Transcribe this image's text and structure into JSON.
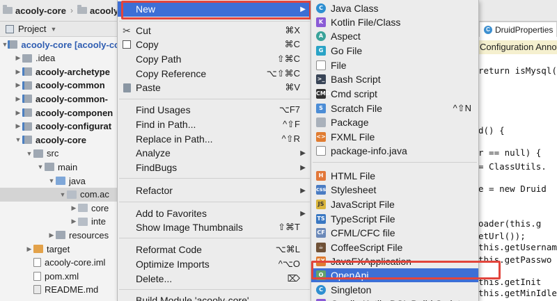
{
  "breadcrumb": [
    "acooly-core",
    "acooly-co"
  ],
  "project_header": {
    "label": "Project"
  },
  "tree": [
    {
      "label": "acooly-core [acooly-co",
      "style": "blue",
      "arrow": "▼",
      "depth": 0,
      "icon": "ic-mod"
    },
    {
      "label": ".idea",
      "style": "",
      "arrow": "▶",
      "depth": 1,
      "icon": "ic-folder"
    },
    {
      "label": "acooly-archetype",
      "style": "bold",
      "arrow": "▶",
      "depth": 1,
      "icon": "ic-mod"
    },
    {
      "label": "acooly-common",
      "style": "bold",
      "arrow": "▶",
      "depth": 1,
      "icon": "ic-mod"
    },
    {
      "label": "acooly-common-",
      "style": "bold",
      "arrow": "▶",
      "depth": 1,
      "icon": "ic-mod"
    },
    {
      "label": "acooly-componen",
      "style": "bold",
      "arrow": "▶",
      "depth": 1,
      "icon": "ic-mod"
    },
    {
      "label": "acooly-configurat",
      "style": "bold",
      "arrow": "▶",
      "depth": 1,
      "icon": "ic-mod"
    },
    {
      "label": "acooly-core",
      "style": "bold",
      "arrow": "▼",
      "depth": 1,
      "icon": "ic-mod"
    },
    {
      "label": "src",
      "style": "",
      "arrow": "▼",
      "depth": 2,
      "icon": "ic-folder"
    },
    {
      "label": "main",
      "style": "",
      "arrow": "▼",
      "depth": 3,
      "icon": "ic-folder"
    },
    {
      "label": "java",
      "style": "",
      "arrow": "▼",
      "depth": 4,
      "icon": "ic-src"
    },
    {
      "label": "com.ac",
      "style": "",
      "arrow": "▼",
      "depth": 5,
      "icon": "ic-pkg",
      "selected": true
    },
    {
      "label": "core",
      "style": "",
      "arrow": "▶",
      "depth": 6,
      "icon": "ic-pkg"
    },
    {
      "label": "inte",
      "style": "",
      "arrow": "▶",
      "depth": 6,
      "icon": "ic-pkg"
    },
    {
      "label": "resources",
      "style": "",
      "arrow": "▶",
      "depth": 4,
      "icon": "ic-folder"
    },
    {
      "label": "target",
      "style": "",
      "arrow": "▶",
      "depth": 2,
      "icon": "ic-target"
    },
    {
      "label": "acooly-core.iml",
      "style": "",
      "arrow": "",
      "depth": 2,
      "icon": "ic-file"
    },
    {
      "label": "pom.xml",
      "style": "",
      "arrow": "",
      "depth": 2,
      "icon": "ic-file"
    },
    {
      "label": "README.md",
      "style": "",
      "arrow": "",
      "depth": 2,
      "icon": "ic-md"
    }
  ],
  "menu": {
    "new": {
      "label": "New",
      "submenu_arrow": "▶"
    },
    "cut": {
      "label": "Cut",
      "shortcut": "⌘X"
    },
    "copy": {
      "label": "Copy",
      "shortcut": "⌘C"
    },
    "copy_path": {
      "label": "Copy Path",
      "shortcut": "⇧⌘C"
    },
    "copy_reference": {
      "label": "Copy Reference",
      "shortcut": "⌥⇧⌘C"
    },
    "paste": {
      "label": "Paste",
      "shortcut": "⌘V"
    },
    "find_usages": {
      "label": "Find Usages",
      "shortcut": "⌥F7"
    },
    "find_in_path": {
      "label": "Find in Path...",
      "shortcut": "^⇧F"
    },
    "replace_in_path": {
      "label": "Replace in Path...",
      "shortcut": "^⇧R"
    },
    "analyze": {
      "label": "Analyze",
      "submenu_arrow": "▶"
    },
    "findbugs": {
      "label": "FindBugs",
      "submenu_arrow": "▶"
    },
    "refactor": {
      "label": "Refactor",
      "submenu_arrow": "▶"
    },
    "add_to_favorites": {
      "label": "Add to Favorites",
      "submenu_arrow": "▶"
    },
    "show_image_thumbnails": {
      "label": "Show Image Thumbnails",
      "shortcut": "⇧⌘T"
    },
    "reformat_code": {
      "label": "Reformat Code",
      "shortcut": "⌥⌘L"
    },
    "optimize_imports": {
      "label": "Optimize Imports",
      "shortcut": "^⌥O"
    },
    "delete": {
      "label": "Delete...",
      "shortcut": "⌦"
    },
    "build_module": {
      "label": "Build Module 'acooly-core'"
    }
  },
  "submenu": {
    "items": [
      {
        "label": "Java Class",
        "icon": "c-java",
        "glyph": "C",
        "round": true
      },
      {
        "label": "Kotlin File/Class",
        "icon": "c-kotlin",
        "glyph": "K",
        "round": false
      },
      {
        "label": "Aspect",
        "icon": "c-aspect",
        "glyph": "A",
        "round": true
      },
      {
        "label": "Go File",
        "icon": "c-go",
        "glyph": "G",
        "round": false
      },
      {
        "label": "File",
        "icon": "c-file",
        "glyph": "",
        "round": false
      },
      {
        "label": "Bash Script",
        "icon": "c-bash",
        "glyph": ">_",
        "round": false
      },
      {
        "label": "Cmd script",
        "icon": "c-cmd",
        "glyph": "CMD",
        "round": false
      },
      {
        "label": "Scratch File",
        "icon": "c-scratch",
        "glyph": "S",
        "round": false,
        "shortcut": "^⇧N"
      },
      {
        "label": "Package",
        "icon": "c-pkg",
        "glyph": "",
        "round": false
      },
      {
        "label": "FXML File",
        "icon": "c-fxml",
        "glyph": "<>",
        "round": false
      },
      {
        "label": "package-info.java",
        "icon": "c-pinfo",
        "glyph": "",
        "round": false
      },
      {
        "label": "HTML File",
        "icon": "c-html",
        "glyph": "H",
        "round": false
      },
      {
        "label": "Stylesheet",
        "icon": "c-css",
        "glyph": "css",
        "round": false
      },
      {
        "label": "JavaScript File",
        "icon": "c-js",
        "glyph": "JS",
        "round": false
      },
      {
        "label": "TypeScript File",
        "icon": "c-ts",
        "glyph": "TS",
        "round": false
      },
      {
        "label": "CFML/CFC file",
        "icon": "c-cf",
        "glyph": "CF",
        "round": false
      },
      {
        "label": "CoffeeScript File",
        "icon": "c-coffee",
        "glyph": "☕",
        "round": false
      },
      {
        "label": "JavaFXApplication",
        "icon": "c-fxapp",
        "glyph": "FX",
        "round": false
      },
      {
        "label": "OpenApi",
        "icon": "c-openapi",
        "glyph": "O",
        "round": false,
        "highlighted": true
      },
      {
        "label": "Singleton",
        "icon": "c-single",
        "glyph": "C",
        "round": true
      },
      {
        "label": "Gradle Kotlin DSL Build Script",
        "icon": "c-kotlin",
        "glyph": "K",
        "round": false
      }
    ]
  },
  "editor": {
    "tab": "DruidProperties",
    "banner": "Configuration Annotation Processor to update",
    "lines": [
      {
        "text": "return isMysql(th",
        "kwfirst": "return"
      },
      {
        "text": "d() {",
        "kwfirst": ""
      },
      {
        "text": "r == null) {",
        "kwfirst": ""
      },
      {
        "text": "= ClassUtils.",
        "kwfirst": ""
      },
      {
        "text": "e = new Druid",
        "kwfirst": ""
      },
      {
        "text": "oader(this.g",
        "kwfirst": ""
      },
      {
        "text": "etUrl());",
        "kwfirst": ""
      },
      {
        "text": "this.getUsernam",
        "kwfirst": ""
      },
      {
        "text": "this.getPasswo",
        "kwfirst": ""
      },
      {
        "text": "this.getInit",
        "kwfirst": ""
      },
      {
        "text": "this.getMinIdle(",
        "kwfirst": ""
      }
    ]
  }
}
